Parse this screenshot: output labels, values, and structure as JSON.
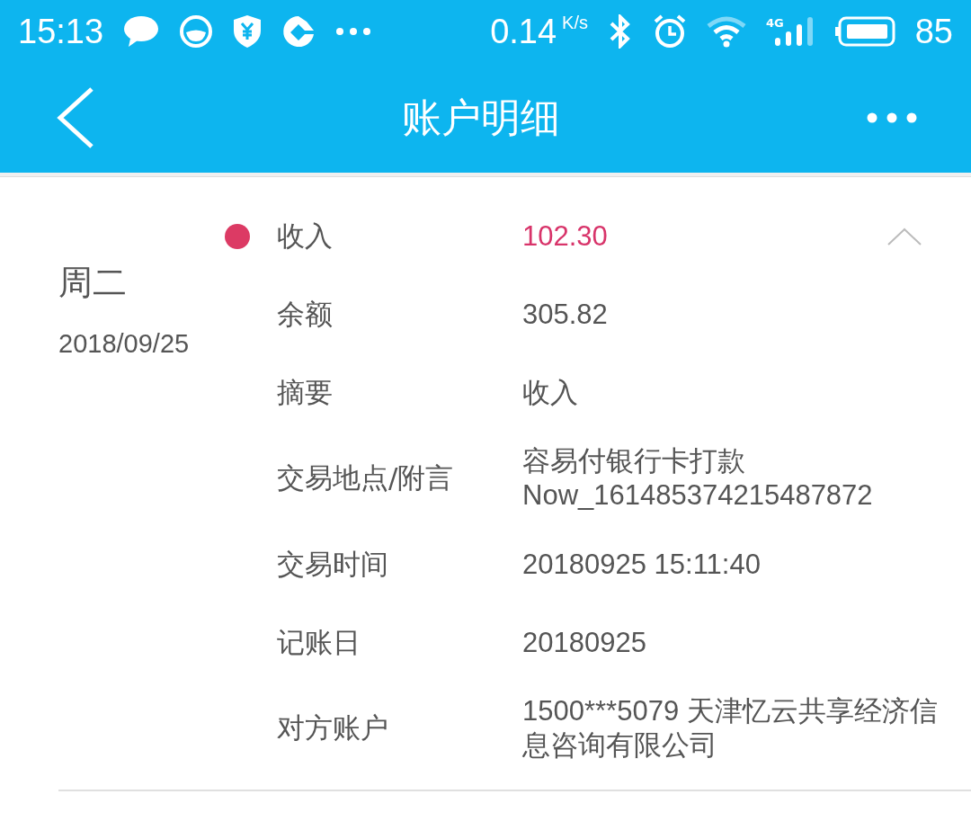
{
  "status_bar": {
    "time": "15:13",
    "speed": "0.14",
    "speed_unit": "K/s",
    "network": "4G",
    "battery": "85"
  },
  "header": {
    "title": "账户明细"
  },
  "transaction": {
    "weekday": "周二",
    "date": "2018/09/25",
    "expanded": true,
    "rows": [
      {
        "label": "收入",
        "value": "102.30",
        "emphasis": true
      },
      {
        "label": "余额",
        "value": "305.82",
        "emphasis": false
      },
      {
        "label": "摘要",
        "value": "收入",
        "emphasis": false
      },
      {
        "label": "交易地点/附言",
        "value": "容易付银行卡打款 Now_161485374215487872",
        "emphasis": false
      },
      {
        "label": "交易时间",
        "value": "20180925 15:11:40",
        "emphasis": false
      },
      {
        "label": "记账日",
        "value": "20180925",
        "emphasis": false
      },
      {
        "label": "对方账户",
        "value": "1500***5079 天津忆云共享经济信息咨询有限公司",
        "emphasis": false
      }
    ]
  }
}
